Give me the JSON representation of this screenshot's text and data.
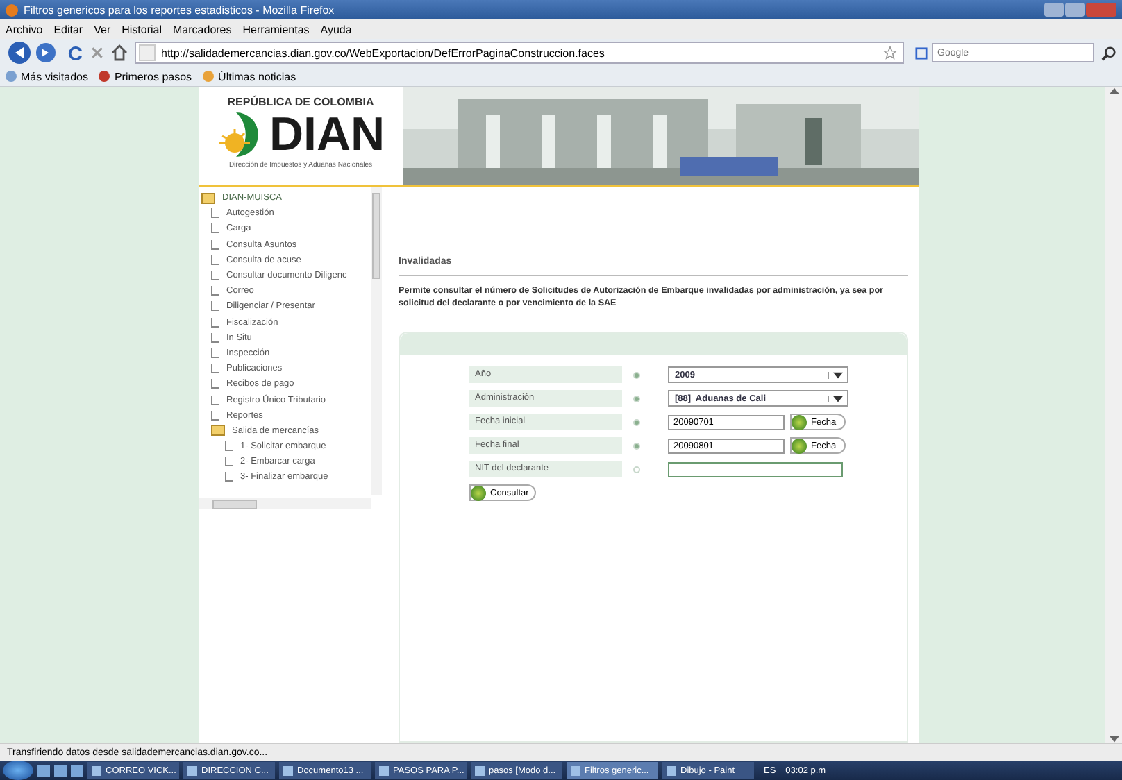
{
  "window": {
    "title": "Filtros genericos para los reportes estadisticos - Mozilla Firefox"
  },
  "menu": [
    "Archivo",
    "Editar",
    "Ver",
    "Historial",
    "Marcadores",
    "Herramientas",
    "Ayuda"
  ],
  "address": "http://salidademercancias.dian.gov.co/WebExportacion/DefErrorPaginaConstruccion.faces",
  "search": {
    "placeholder": "Google"
  },
  "bookmarks": [
    "Más visitados",
    "Primeros pasos",
    "Últimas noticias"
  ],
  "header": {
    "country": "REPÚBLICA DE COLOMBIA",
    "logo": "DIAN",
    "subtitle": "Dirección de Impuestos y Aduanas Nacionales"
  },
  "tree": {
    "label": "DIAN-MUISCA",
    "expanded": true,
    "children": [
      {
        "label": "Autogestión"
      },
      {
        "label": "Carga"
      },
      {
        "label": "Consulta Asuntos"
      },
      {
        "label": "Consulta de acuse"
      },
      {
        "label": "Consultar documento Diligenc"
      },
      {
        "label": "Correo"
      },
      {
        "label": "Diligenciar / Presentar"
      },
      {
        "label": "Fiscalización"
      },
      {
        "label": "In Situ"
      },
      {
        "label": "Inspección"
      },
      {
        "label": "Publicaciones"
      },
      {
        "label": "Recibos de pago"
      },
      {
        "label": "Registro Único Tributario"
      },
      {
        "label": "Reportes"
      },
      {
        "label": "Salida de mercancías",
        "expanded": true,
        "children": [
          {
            "label": "1- Solicitar embarque"
          },
          {
            "label": "2- Embarcar carga"
          },
          {
            "label": "3- Finalizar embarque"
          }
        ]
      }
    ]
  },
  "section_title": "Invalidadas",
  "description": "Permite consultar el número de Solicitudes de Autorización de Embarque invalidadas por administración, ya sea por solicitud del declarante o por vencimiento de la SAE",
  "form": [
    {
      "kind": "select",
      "label": "Año",
      "required": true,
      "value": "2009"
    },
    {
      "kind": "select",
      "label": "Administración",
      "required": true,
      "value": "[88]  Aduanas de Cali"
    },
    {
      "kind": "date",
      "label": "Fecha inicial",
      "required": true,
      "value": "20090701",
      "button": "Fecha"
    },
    {
      "kind": "date",
      "label": "Fecha final",
      "required": true,
      "value": "20090801",
      "button": "Fecha"
    },
    {
      "kind": "text",
      "label": "NIT del declarante",
      "required": false
    }
  ],
  "submit": "Consultar",
  "status_bar": "Transfiriendo datos desde salidademercancias.dian.gov.co...",
  "taskbar": [
    {
      "label": "CORREO VICK...",
      "selected": false
    },
    {
      "label": "DIRECCION C...",
      "selected": false
    },
    {
      "label": "Documento13 ...",
      "selected": false
    },
    {
      "label": "PASOS PARA P...",
      "selected": false
    },
    {
      "label": "pasos [Modo d...",
      "selected": false
    },
    {
      "label": "Filtros generic...",
      "selected": true
    },
    {
      "label": "Dibujo - Paint",
      "selected": false
    }
  ],
  "tray": {
    "language": "ES",
    "clock": "03:02 p.m"
  }
}
